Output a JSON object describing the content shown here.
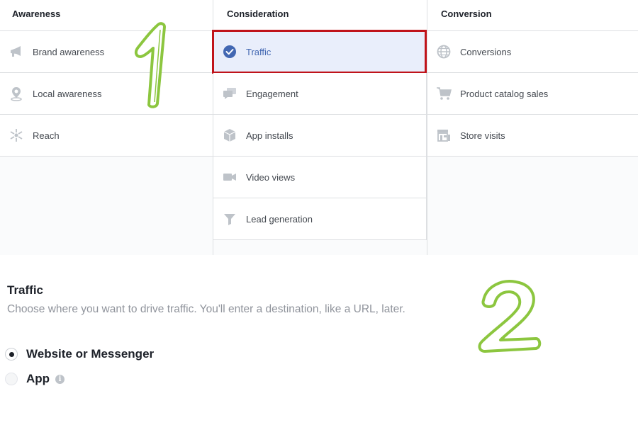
{
  "columns": [
    {
      "header": "Awareness",
      "items": [
        {
          "label": "Brand awareness",
          "icon": "megaphone-icon"
        },
        {
          "label": "Local awareness",
          "icon": "location-pin-icon"
        },
        {
          "label": "Reach",
          "icon": "reach-icon"
        }
      ]
    },
    {
      "header": "Consideration",
      "items": [
        {
          "label": "Traffic",
          "icon": "checkmark-circle-icon",
          "selected": true
        },
        {
          "label": "Engagement",
          "icon": "speech-bubbles-icon"
        },
        {
          "label": "App installs",
          "icon": "box-icon"
        },
        {
          "label": "Video views",
          "icon": "video-camera-icon"
        },
        {
          "label": "Lead generation",
          "icon": "funnel-icon"
        }
      ]
    },
    {
      "header": "Conversion",
      "items": [
        {
          "label": "Conversions",
          "icon": "globe-icon"
        },
        {
          "label": "Product catalog sales",
          "icon": "shopping-cart-icon"
        },
        {
          "label": "Store visits",
          "icon": "store-icon"
        }
      ]
    }
  ],
  "detail": {
    "title": "Traffic",
    "description": "Choose where you want to drive traffic. You'll enter a destination, like a URL, later.",
    "options": [
      {
        "label": "Website or Messenger",
        "checked": true
      },
      {
        "label": "App",
        "checked": false,
        "info_icon": "info-icon",
        "info_glyph": "i"
      }
    ]
  },
  "annotations": {
    "step1": "1",
    "step2": "2"
  },
  "colors": {
    "selected_border": "#c0131a",
    "selected_bg": "#e9eefb",
    "accent": "#4267b2",
    "annotation_green": "#8cc63f"
  }
}
